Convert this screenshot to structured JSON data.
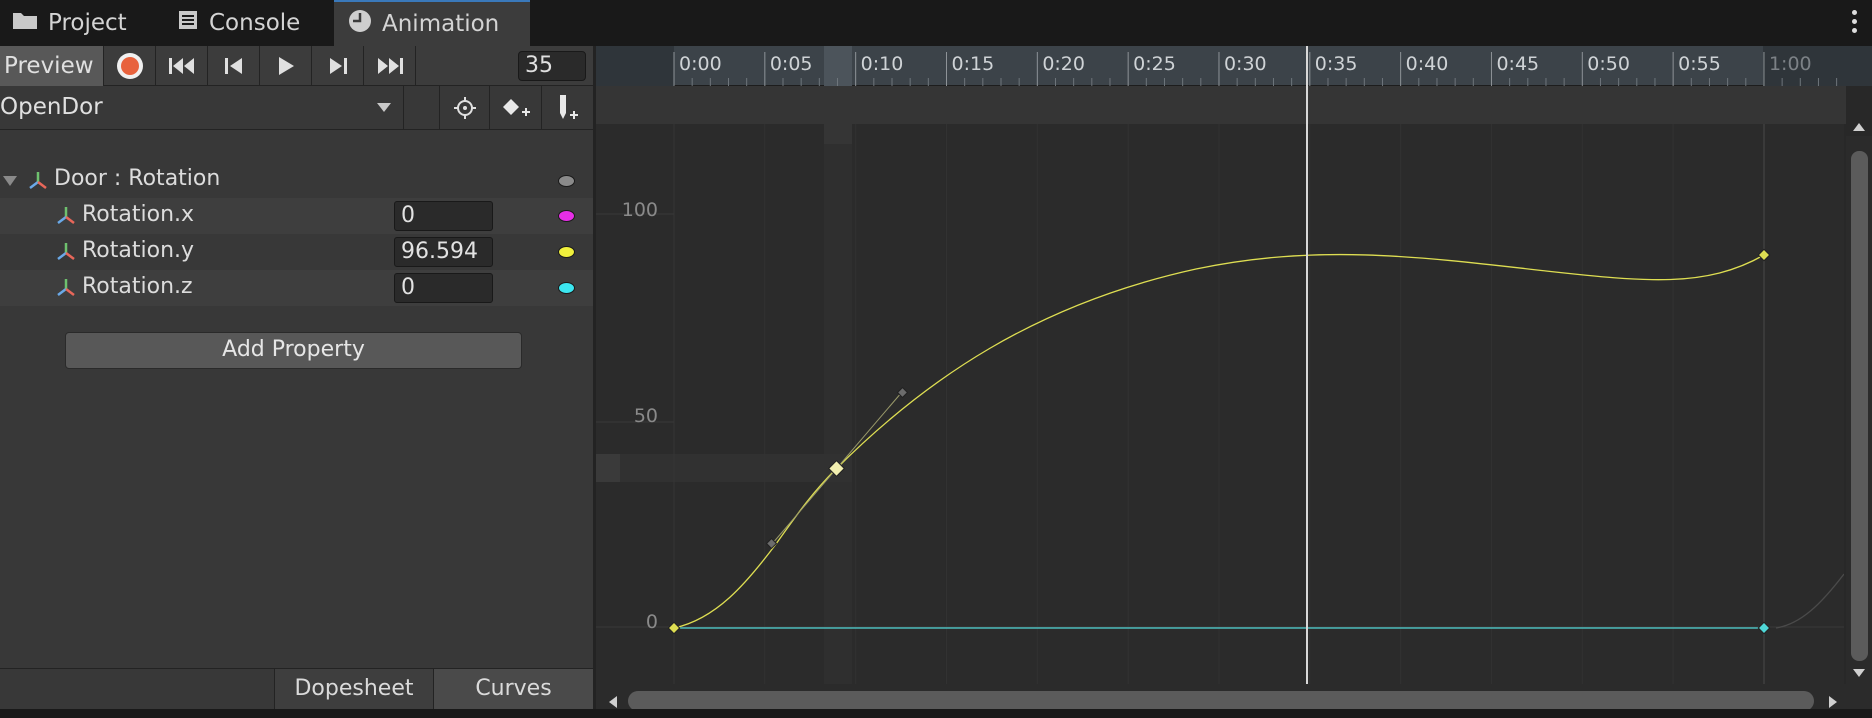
{
  "tabs": [
    {
      "label": "Project",
      "icon": "folder-icon"
    },
    {
      "label": "Console",
      "icon": "console-icon"
    },
    {
      "label": "Animation",
      "icon": "clock-icon",
      "active": true
    }
  ],
  "toolbar": {
    "preview_label": "Preview",
    "frame_value": "35"
  },
  "clip": {
    "name": "OpenDor"
  },
  "properties": {
    "group_label": "Door : Rotation",
    "items": [
      {
        "label": "Rotation.x",
        "value": "0",
        "color": "#e62ee6"
      },
      {
        "label": "Rotation.y",
        "value": "96.594",
        "color": "#f0f03c"
      },
      {
        "label": "Rotation.z",
        "value": "0",
        "color": "#3ce6f0"
      }
    ],
    "group_color": "#8a8a8a"
  },
  "add_property_label": "Add Property",
  "view_buttons": {
    "dopesheet": "Dopesheet",
    "curves": "Curves",
    "active": "Curves"
  },
  "timeline": {
    "ticks": [
      "0:00",
      "0:05",
      "0:10",
      "0:15",
      "0:20",
      "0:25",
      "0:30",
      "0:35",
      "0:40",
      "0:45",
      "0:50",
      "0:55",
      "1:00"
    ],
    "playhead_frame": 35
  },
  "curve_axis": {
    "labels": [
      "100",
      "50",
      "0"
    ]
  },
  "colors": {
    "accent": "#3a79bb",
    "record": "#e8623d",
    "curve_y": "#dede52",
    "curve_z": "#4fd6d6"
  }
}
